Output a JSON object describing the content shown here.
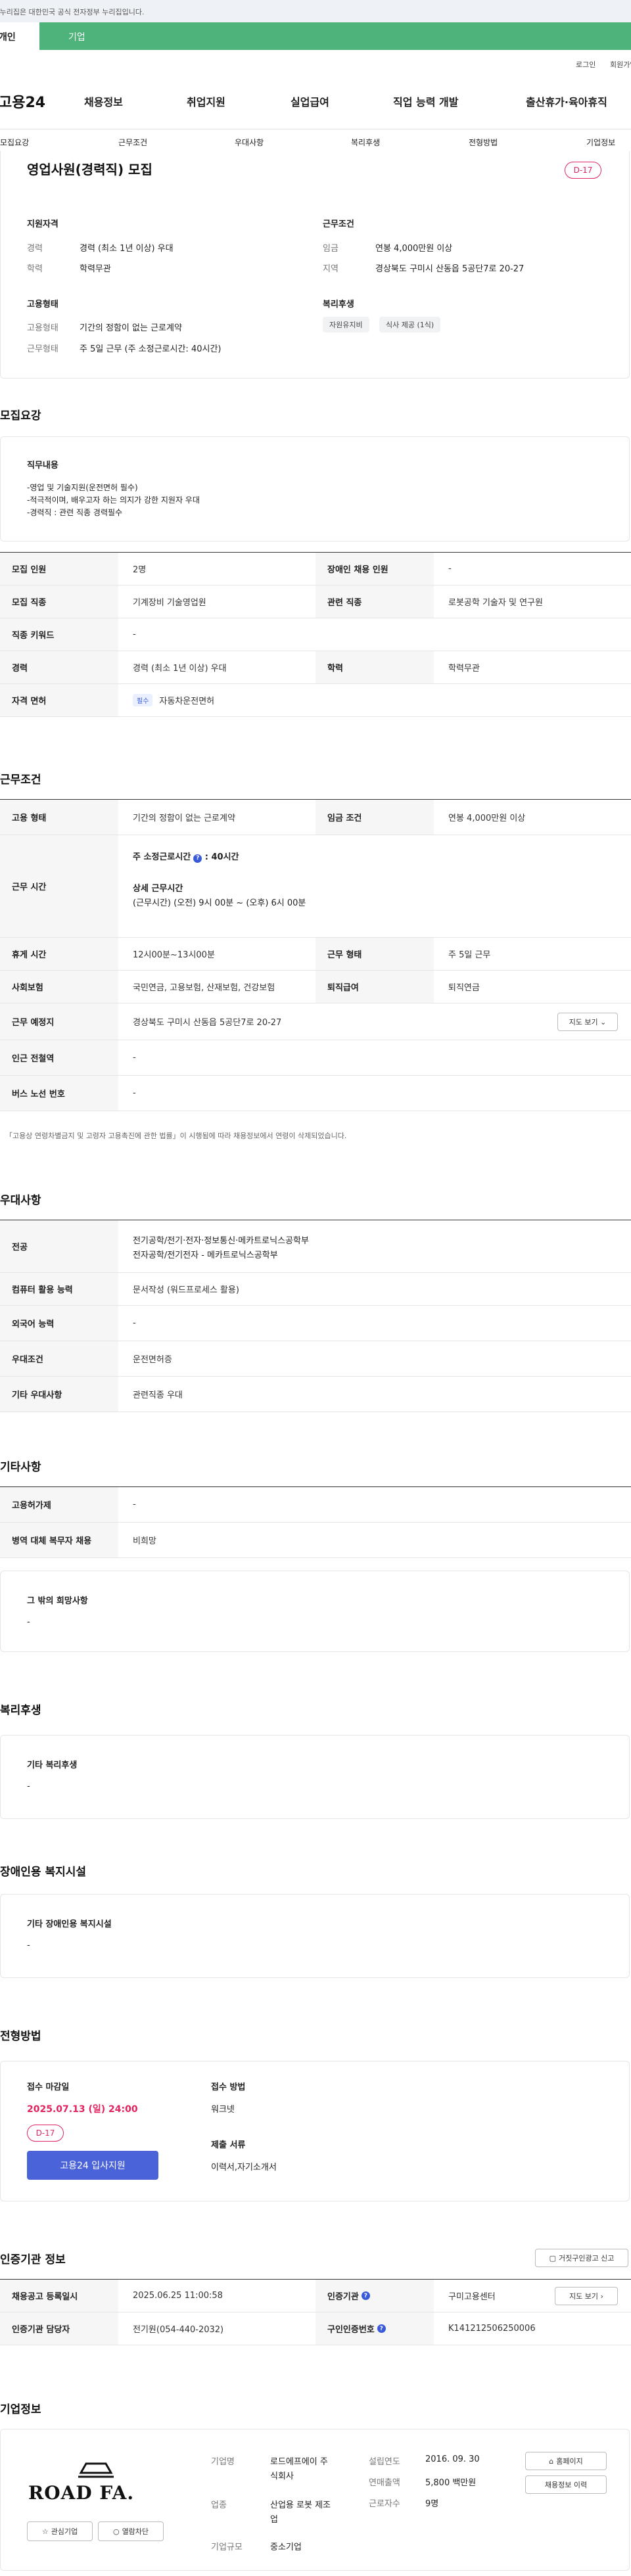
{
  "gov_banner": "이 누리집은 대한민국 공식 전자정부 누리집입니다.",
  "user_tabs": [
    "개인",
    "기업"
  ],
  "util_links": [
    "로그인",
    "회원가입"
  ],
  "brand": "고용24",
  "gnb": [
    "채용정보",
    "취업지원",
    "실업급여",
    "직업 능력 개발",
    "출산휴가·육아휴직"
  ],
  "subnav": [
    "모집요강",
    "근무조건",
    "우대사항",
    "복리후생",
    "전형방법",
    "기업정보"
  ],
  "job_title": "영업사원(경력직) 모집",
  "d_day": "D-17",
  "summary": {
    "qual_title": "지원자격",
    "cond_title": "근무조건",
    "emp_title": "고용형태",
    "welfare_title": "복리후생",
    "career_label": "경력",
    "career_value": "경력 (최소 1년 이상) 우대",
    "edu_label": "학력",
    "edu_value": "학력무관",
    "wage_label": "임금",
    "wage_value": "연봉 4,000만원 이상",
    "region_label": "지역",
    "region_value": "경상북도 구미시 산동읍 5공단7로 20-27",
    "emptype_label": "고용형태",
    "emptype_value": "기간의 정함이 없는 근로계약",
    "worktype_label": "근무형태",
    "worktype_value": "주 5일 근무 (주 소정근로시간: 40시간)",
    "welfare_tags": [
      "자원유지비",
      "식사 제공 (1식)"
    ]
  },
  "recruit": {
    "title": "모집요강",
    "duty_title": "직무내용",
    "duty_lines": [
      "-영업 및 기술지원(운전면허 필수)",
      "-적극적이며, 배우고자 하는 의지가 강한 지원자 우대",
      "-경력직 : 관련 직종 경력필수"
    ],
    "r1h": "모집 인원",
    "r1v": "2명",
    "r1h2": "장애인 채용 인원",
    "r1v2": "-",
    "r2h": "모집 직종",
    "r2v": "기계장비 기술영업원",
    "r2h2": "관련 직종",
    "r2v2": "로봇공학 기술자 및 연구원",
    "r3h": "직종 키워드",
    "r3v": "-",
    "r4h": "경력",
    "r4v": "경력 (최소 1년 이상) 우대",
    "r4h2": "학력",
    "r4v2": "학력무관",
    "r5h": "자격 면허",
    "r5tag": "필수",
    "r5v": "자동차운전면허"
  },
  "conditions": {
    "title": "근무조건",
    "c1h": "고용 형태",
    "c1v": "기간의 정함이 없는 근로계약",
    "c1h2": "임금 조건",
    "c1v2": "연봉 4,000만원 이상",
    "c2h": "근무 시간",
    "c2v_a": "주 소정근로시간",
    "c2v_b": ": 40시간",
    "c2v_c": "상세 근무시간",
    "c2v_d": "(근무시간) (오전) 9시 00분 ~ (오후) 6시 00분",
    "c3h": "휴게 시간",
    "c3v": "12시00분~13시00분",
    "c3h2": "근무 형태",
    "c3v2": "주 5일 근무",
    "c4h": "사회보험",
    "c4v": "국민연금, 고용보험, 산재보험, 건강보험",
    "c4h2": "퇴직급여",
    "c4v2": "퇴직연금",
    "c5h": "근무 예정지",
    "c5v": "경상북도 구미시 산동읍 5공단7로 20-27",
    "map_btn": "지도 보기",
    "c6h": "인근 전철역",
    "c6v": "-",
    "c7h": "버스 노선 번호",
    "c7v": "-",
    "note": "「고용상 연령차별금지 및 고령자 고용촉진에 관한 법률」이 시행됨에 따라 채용정보에서 연령이 삭제되었습니다."
  },
  "pref": {
    "title": "우대사항",
    "p1h": "전공",
    "p1v_a": "전기공학/전기·전자·정보통신·메카트로닉스공학부",
    "p1v_b": "전자공학/전기전자 - 메카트로닉스공학부",
    "p2h": "컴퓨터 활용 능력",
    "p2v": "문서작성 (워드프로세스 활용)",
    "p3h": "외국어 능력",
    "p3v": "-",
    "p4h": "우대조건",
    "p4v": "운전면허증",
    "p5h": "기타 우대사항",
    "p5v": "관련직종 우대"
  },
  "etc": {
    "title": "기타사항",
    "e1h": "고용허가제",
    "e1v": "-",
    "e2h": "병역 대체 복무자 채용",
    "e2v": "비희망",
    "card_title": "그 밖의 희망사항",
    "card_value": "-"
  },
  "welfare": {
    "title": "복리후생",
    "card_title": "기타 복리후생",
    "card_value": "-"
  },
  "disability": {
    "title": "장애인용 복지시설",
    "card_title": "기타 장애인용 복지시설",
    "card_value": "-"
  },
  "selection": {
    "title": "전형방법",
    "deadline_label": "접수 마감일",
    "deadline_value": "2025.07.13 (일) 24:00",
    "d_day": "D-17",
    "apply_btn": "고용24 입사지원",
    "method_label": "접수 방법",
    "method_value": "워크넷",
    "docs_label": "제출 서류",
    "docs_value": "이력서,자기소개서"
  },
  "cert": {
    "title": "인증기관 정보",
    "report_btn": "거짓구인광고 신고",
    "a1h": "채용공고 등록일시",
    "a1v": "2025.06.25 11:00:58",
    "a1h2": "인증기관",
    "a1v2": "구미고용센터",
    "map_btn": "지도 보기",
    "a2h": "인증기관 담당자",
    "a2v": "전기원(054-440-2032)",
    "a2h2": "구인인증번호",
    "a2v2": "K141212506250006"
  },
  "company": {
    "title": "기업정보",
    "logo_text": "ROAD FA.",
    "fav_btn": "관심기업",
    "block_btn": "열람차단",
    "name_label": "기업명",
    "name_value_a": "로드에프에이 주",
    "name_value_b": "식회사",
    "industry_label": "업종",
    "industry_value_a": "산업용 로봇 제조",
    "industry_value_b": "업",
    "size_label": "기업규모",
    "size_value": "중소기업",
    "founded_label": "설립연도",
    "founded_value": "2016. 09. 30",
    "sales_label": "연매출액",
    "sales_value": "5,800 백만원",
    "emp_label": "근로자수",
    "emp_value": "9명",
    "homepage_btn": "홈페이지",
    "history_btn": "채용정보 이력"
  },
  "colors": {
    "accent_green": "#4db37a",
    "accent_blue": "#3a5bd9",
    "dday_red": "#e0245e"
  }
}
